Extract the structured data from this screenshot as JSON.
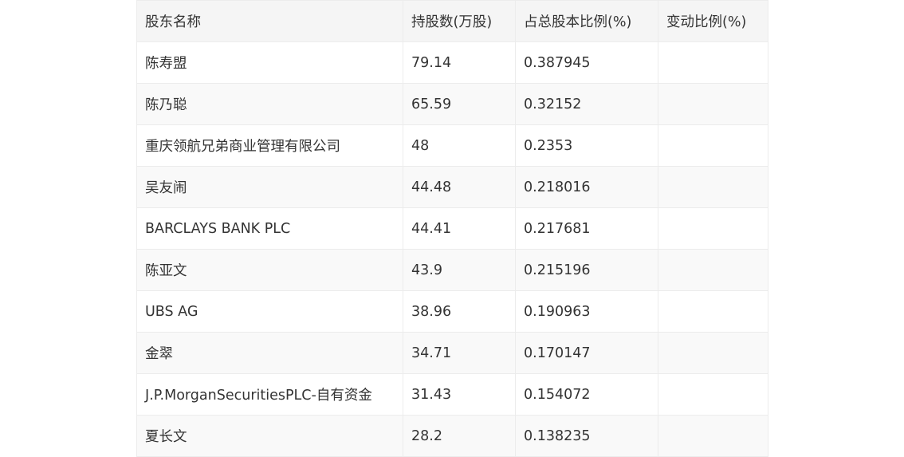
{
  "table": {
    "headers": [
      "股东名称",
      "持股数(万股)",
      "占总股本比例(%)",
      "变动比例(%)"
    ],
    "rows": [
      [
        "陈寿盟",
        "79.14",
        "0.387945",
        ""
      ],
      [
        "陈乃聪",
        "65.59",
        "0.32152",
        ""
      ],
      [
        "重庆领航兄弟商业管理有限公司",
        "48",
        "0.2353",
        ""
      ],
      [
        "吴友闹",
        "44.48",
        "0.218016",
        ""
      ],
      [
        "BARCLAYS BANK PLC",
        "44.41",
        "0.217681",
        ""
      ],
      [
        "陈亚文",
        "43.9",
        "0.215196",
        ""
      ],
      [
        "UBS AG",
        "38.96",
        "0.190963",
        ""
      ],
      [
        "金翠",
        "34.71",
        "0.170147",
        ""
      ],
      [
        "J.P.MorganSecuritiesPLC-自有资金",
        "31.43",
        "0.154072",
        ""
      ],
      [
        "夏长文",
        "28.2",
        "0.138235",
        ""
      ]
    ]
  }
}
